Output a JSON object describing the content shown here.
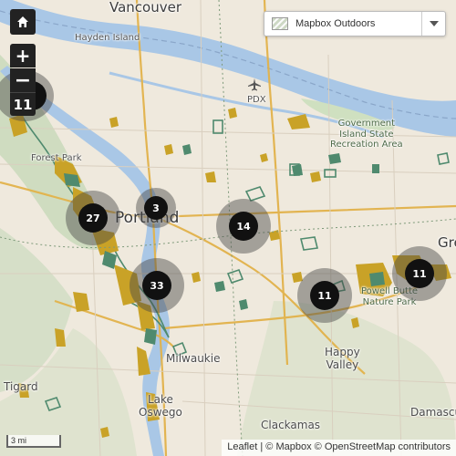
{
  "controls": {
    "home_icon": "home-icon",
    "zoom_in_label": "+",
    "zoom_out_label": "−",
    "zoom_level": "11"
  },
  "basemap": {
    "selected": "Mapbox Outdoors",
    "thumb_icon": "map-thumbnail-icon",
    "arrow_icon": "caret-down-icon"
  },
  "places": {
    "vancouver": "Vancouver",
    "hayden_island": "Hayden Island",
    "pdx": "PDX",
    "government_island": "Government\nIsland State\nRecreation Area",
    "forest_park": "Forest Park",
    "portland": "Portland",
    "milwaukie": "Milwaukie",
    "happy_valley": "Happy\nValley",
    "tigard": "Tigard",
    "lake_oswego": "Lake\nOswego",
    "clackamas": "Clackamas",
    "damascus": "Damascu",
    "powell_butte": "Powell Butte\nNature Park",
    "gresham_partial": "Gre"
  },
  "clusters": [
    {
      "name": "cluster-partial-left",
      "count": "",
      "size": "large"
    },
    {
      "name": "cluster-27",
      "count": "27",
      "size": "large"
    },
    {
      "name": "cluster-3",
      "count": "3",
      "size": "small"
    },
    {
      "name": "cluster-14",
      "count": "14",
      "size": "large"
    },
    {
      "name": "cluster-33",
      "count": "33",
      "size": "large"
    },
    {
      "name": "cluster-11-a",
      "count": "11",
      "size": "large"
    },
    {
      "name": "cluster-11-b",
      "count": "11",
      "size": "large"
    }
  ],
  "scale": {
    "label": "3 mi"
  },
  "attribution": {
    "leaflet": "Leaflet",
    "separator": "| ©",
    "mapbox": "Mapbox",
    "copy": "©",
    "osm": "OpenStreetMap contributors"
  },
  "colors": {
    "land": "#efe9dd",
    "water": "#a9c7e6",
    "park_green": "#4f8a6e",
    "feature_gold": "#c9a227",
    "forest": "#c8d8b8",
    "cluster_core": "#111111",
    "cluster_halo": "rgba(70,70,70,0.45)"
  }
}
